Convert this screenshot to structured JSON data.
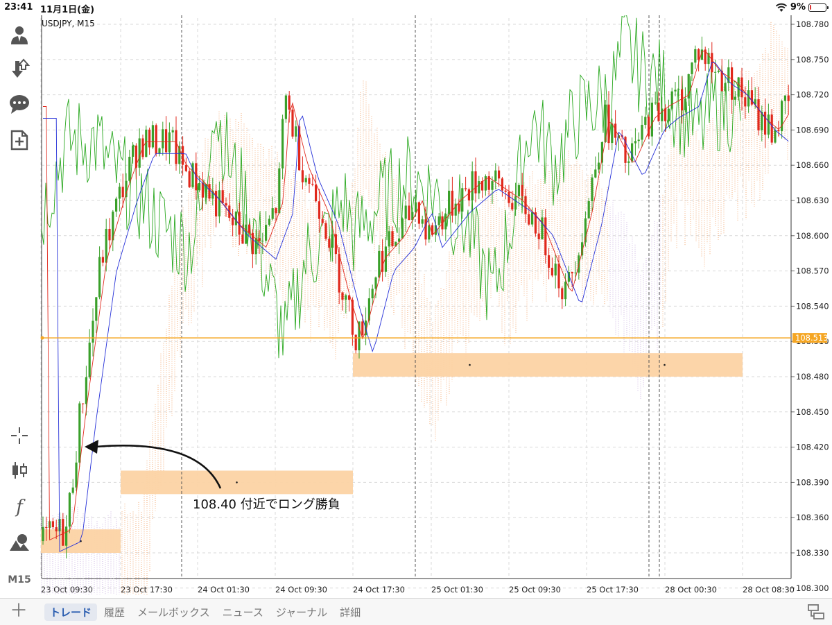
{
  "status": {
    "time": "23:41",
    "date": "11月1日(金)",
    "battery": "9%",
    "battery_level": 0.09
  },
  "chart": {
    "symbol": "USDJPY, M15",
    "price_line_label": "108.513",
    "current_price": 108.513,
    "annotation_text": "108.40 付近でロング勝負",
    "price_axis_labels": [
      "108.780",
      "108.750",
      "108.720",
      "108.690",
      "108.660",
      "108.630",
      "108.600",
      "108.570",
      "108.540",
      "108.510",
      "108.480",
      "108.450",
      "108.420",
      "108.390",
      "108.360",
      "108.330",
      "108.300"
    ],
    "time_axis_labels": [
      "23 Oct 09:30",
      "23 Oct 17:30",
      "24 Oct 01:30",
      "24 Oct 09:30",
      "24 Oct 17:30",
      "25 Oct 01:30",
      "25 Oct 09:30",
      "25 Oct 17:30",
      "28 Oct 00:30",
      "28 Oct 08:30"
    ],
    "colors": {
      "bull": "#3aa02a",
      "bear": "#e0281c",
      "tenkan": "#e0281c",
      "kijun": "#2530d8",
      "chikou": "#29a81f",
      "kumo": "#f4a46a",
      "kumo_lilac": "#c9b0e0",
      "price_line": "#f5a623",
      "zone": "#fcd3a4"
    },
    "zones": [
      {
        "from": "23 Oct 09:30",
        "to": "23 Oct 17:30",
        "high": 108.35,
        "low": 108.33
      },
      {
        "from": "23 Oct 17:30",
        "to": "24 Oct 17:30",
        "high": 108.4,
        "low": 108.38
      },
      {
        "from": "24 Oct 17:30",
        "to": "25 Oct 17:30",
        "high": 108.5,
        "low": 108.48
      },
      {
        "from": "25 Oct 17:30",
        "to": "28 Oct 08:30",
        "high": 108.5,
        "low": 108.48
      }
    ]
  },
  "toolbar": {
    "items": [
      {
        "name": "account-icon"
      },
      {
        "name": "trade-arrows-icon"
      },
      {
        "name": "chat-icon"
      },
      {
        "name": "new-document-icon"
      },
      {
        "name": "crosshair-icon"
      },
      {
        "name": "candles-icon"
      },
      {
        "name": "function-icon"
      },
      {
        "name": "objects-icon"
      }
    ],
    "timeframe": "M15"
  },
  "tabs": {
    "items": [
      "トレード",
      "履歴",
      "メールボックス",
      "ニュース",
      "ジャーナル",
      "詳細"
    ],
    "active": 0
  }
}
